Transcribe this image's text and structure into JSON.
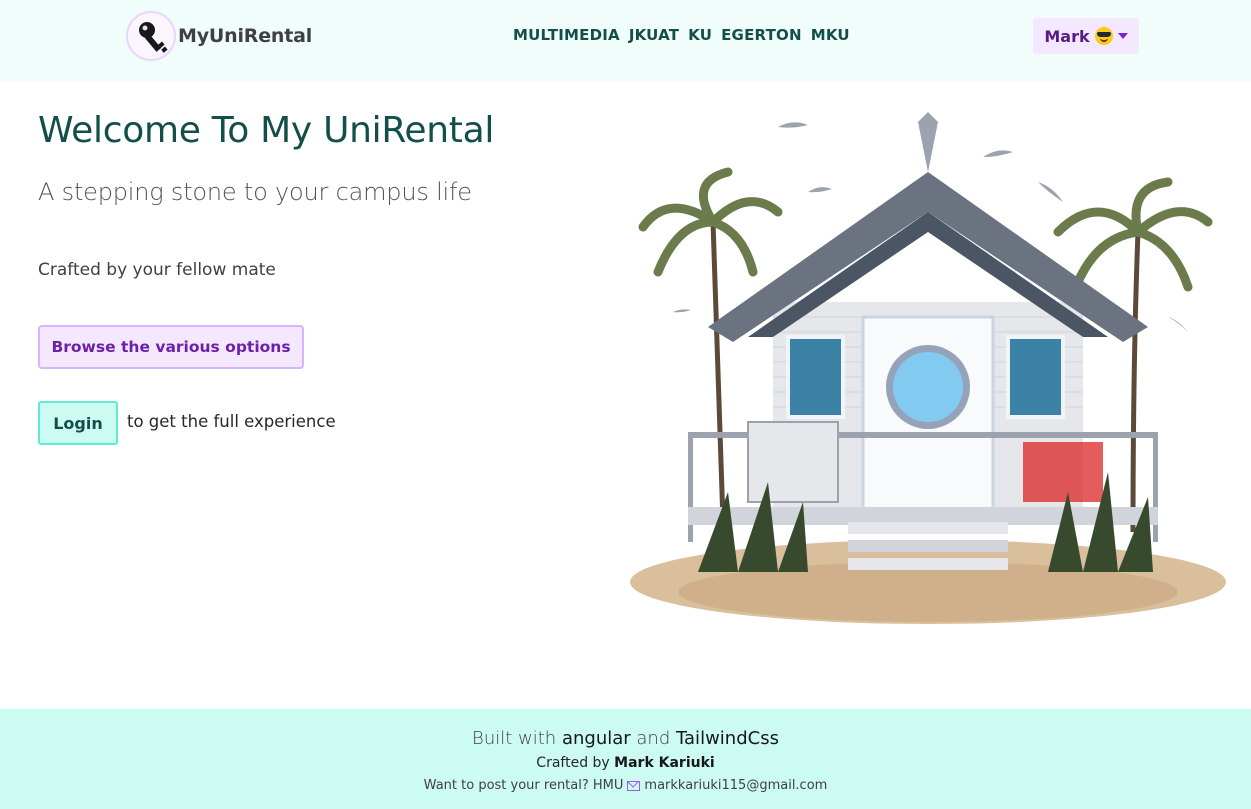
{
  "header": {
    "brand": "MyUniRental",
    "logo_icon": "key-icon",
    "nav": [
      "MULTIMEDIA",
      "JKUAT",
      "KU",
      "EGERTON",
      "MKU"
    ],
    "user": {
      "name": "Mark",
      "emoji_icon": "sunglasses-face-icon",
      "caret_icon": "caret-down-icon"
    }
  },
  "hero": {
    "title": "Welcome To My UniRental",
    "subtitle": "A stepping stone to your campus life",
    "crafted": "Crafted by your fellow mate",
    "browse_label": "Browse the various options",
    "login_label": "Login",
    "login_hint": "to get the full experience",
    "illustration": "beach-house-illustration"
  },
  "footer": {
    "built_prefix": "Built with",
    "tech1": "angular",
    "and": "and",
    "tech2": "TailwindCss",
    "crafted_prefix": "Crafted by",
    "author": "Mark Kariuki",
    "post_text": "Want to post your rental? HMU",
    "email": "markkariuki115@gmail.com"
  },
  "colors": {
    "header_bg": "#f0fdfa",
    "footer_bg": "#ccfbf1",
    "title": "#134e4a",
    "purple_btn_bg": "#f3e8ff",
    "purple_text": "#6b21a8",
    "teal_btn_bg": "#ccfbf1"
  }
}
